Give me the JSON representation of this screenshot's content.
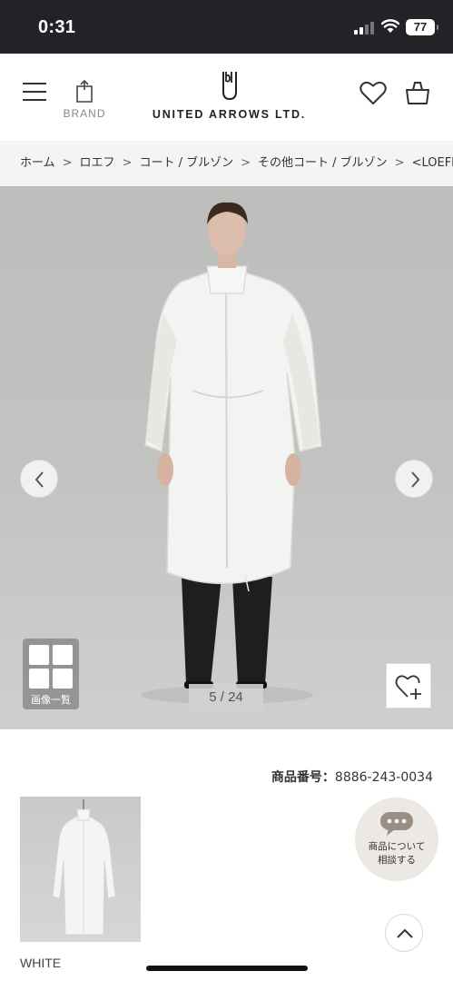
{
  "status_bar": {
    "time": "0:31",
    "battery": "77"
  },
  "header": {
    "brand_label": "BRAND",
    "logo_text": "UNITED ARROWS LTD."
  },
  "breadcrumb": {
    "items": [
      "ホーム",
      "ロエフ",
      "コート / ブルゾン",
      "その他コート / ブルゾン",
      "<LOEFF>"
    ],
    "separator": ">"
  },
  "gallery": {
    "image_list_label": "画像一覧",
    "counter": "5 / 24"
  },
  "product": {
    "number_label": "商品番号：",
    "number_value": "8886-243-0034",
    "color_label": "WHITE"
  },
  "consult": {
    "line1": "商品について",
    "line2": "相談する"
  },
  "colors": {
    "status_bar_bg": "#222326",
    "breadcrumb_bg": "#f4f4f2",
    "consult_bg": "#ece8e3"
  },
  "icons": [
    "menu-icon",
    "brand-bag-icon",
    "logo-mark-icon",
    "heart-icon",
    "cart-icon",
    "chevron-left-icon",
    "chevron-right-icon",
    "grid-icon",
    "heart-plus-icon",
    "chat-bubble-icon",
    "chevron-up-icon"
  ]
}
